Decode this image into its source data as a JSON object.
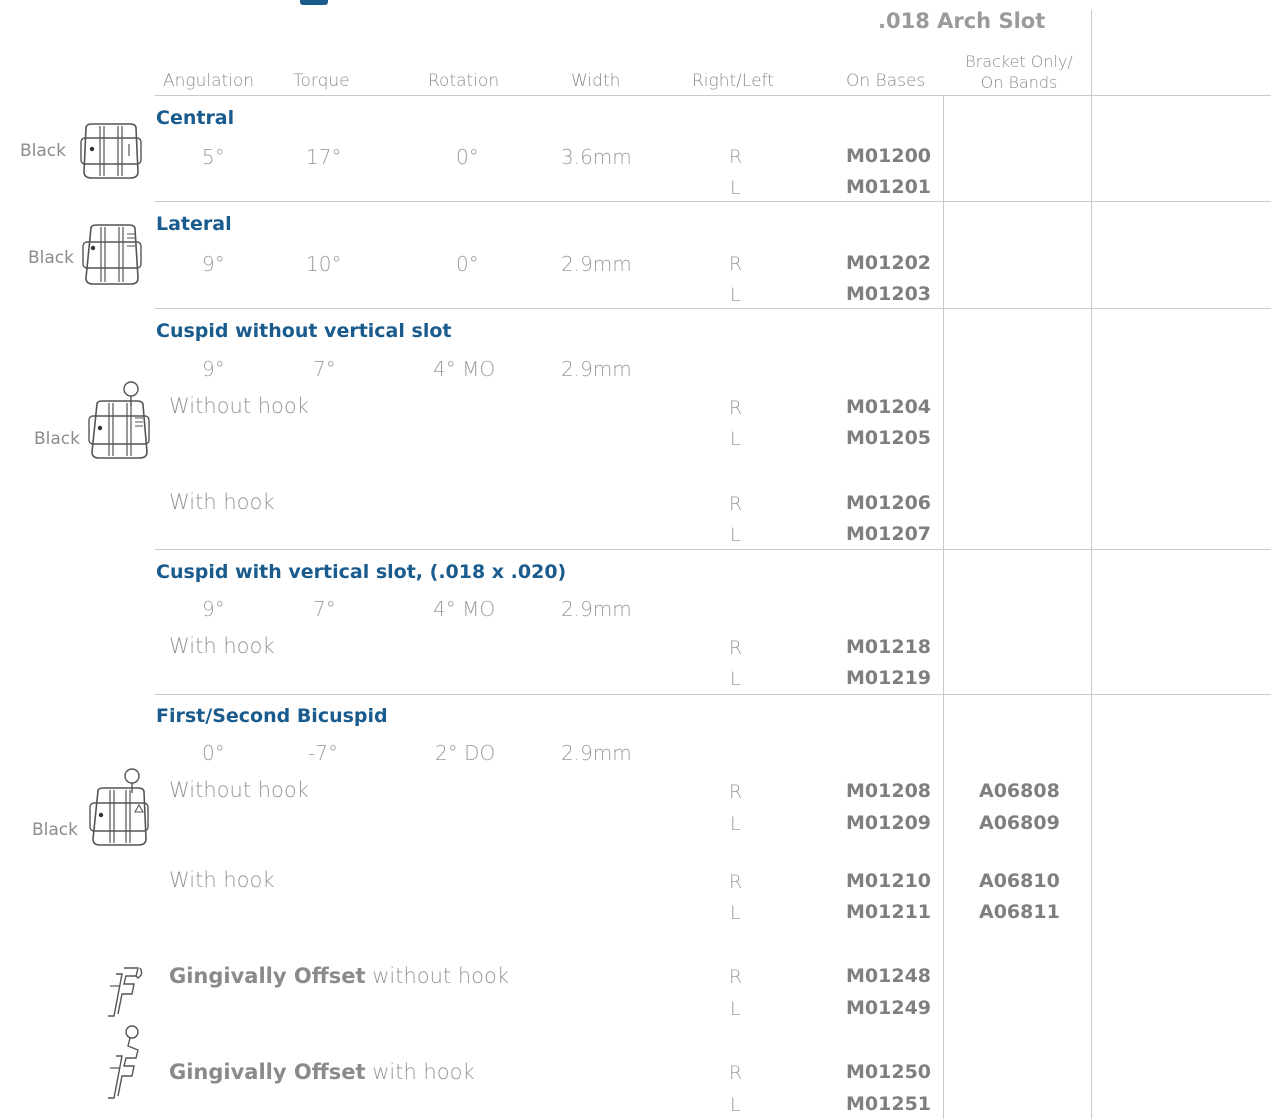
{
  "arch_slot": ".018 Arch Slot",
  "columns": {
    "angulation": "Angulation",
    "torque": "Torque",
    "rotation": "Rotation",
    "width": "Width",
    "right_left": "Right/Left",
    "on_bases": "On Bases",
    "bracket_only_line1": "Bracket Only/",
    "bracket_only_line2": "On Bands"
  },
  "black_label": "Black",
  "central": {
    "title": "Central",
    "angulation": "5°",
    "torque": "17°",
    "rotation": "0°",
    "width": "3.6mm",
    "r": "R",
    "r_code": "M01200",
    "l": "L",
    "l_code": "M01201"
  },
  "lateral": {
    "title": "Lateral",
    "angulation": "9°",
    "torque": "10°",
    "rotation": "0°",
    "width": "2.9mm",
    "r": "R",
    "r_code": "M01202",
    "l": "L",
    "l_code": "M01203"
  },
  "cuspid_no_vslot": {
    "title": "Cuspid without vertical slot",
    "angulation": "9°",
    "torque": "7°",
    "rotation": "4° MO",
    "width": "2.9mm",
    "without_hook": "Without hook",
    "wo_r": "R",
    "wo_r_code": "M01204",
    "wo_l": "L",
    "wo_l_code": "M01205",
    "with_hook": "With hook",
    "w_r": "R",
    "w_r_code": "M01206",
    "w_l": "L",
    "w_l_code": "M01207"
  },
  "cuspid_vslot": {
    "title": "Cuspid with vertical slot, (.018 x .020)",
    "angulation": "9°",
    "torque": "7°",
    "rotation": "4° MO",
    "width": "2.9mm",
    "with_hook": "With hook",
    "r": "R",
    "r_code": "M01218",
    "l": "L",
    "l_code": "M01219"
  },
  "bicuspid": {
    "title": "First/Second Bicuspid",
    "angulation": "0°",
    "torque": "-7°",
    "rotation": "2° DO",
    "width": "2.9mm",
    "without_hook": "Without hook",
    "wo_r": "R",
    "wo_r_code": "M01208",
    "wo_r_band": "A06808",
    "wo_l": "L",
    "wo_l_code": "M01209",
    "wo_l_band": "A06809",
    "with_hook": "With hook",
    "w_r": "R",
    "w_r_code": "M01210",
    "w_r_band": "A06810",
    "w_l": "L",
    "w_l_code": "M01211",
    "w_l_band": "A06811",
    "gingival_bold": "Gingivally Offset",
    "gingival_without": " without hook",
    "g1_r": "R",
    "g1_r_code": "M01248",
    "g1_l": "L",
    "g1_l_code": "M01249",
    "gingival_with": " with hook",
    "g2_r": "R",
    "g2_r_code": "M01250",
    "g2_l": "L",
    "g2_l_code": "M01251"
  }
}
